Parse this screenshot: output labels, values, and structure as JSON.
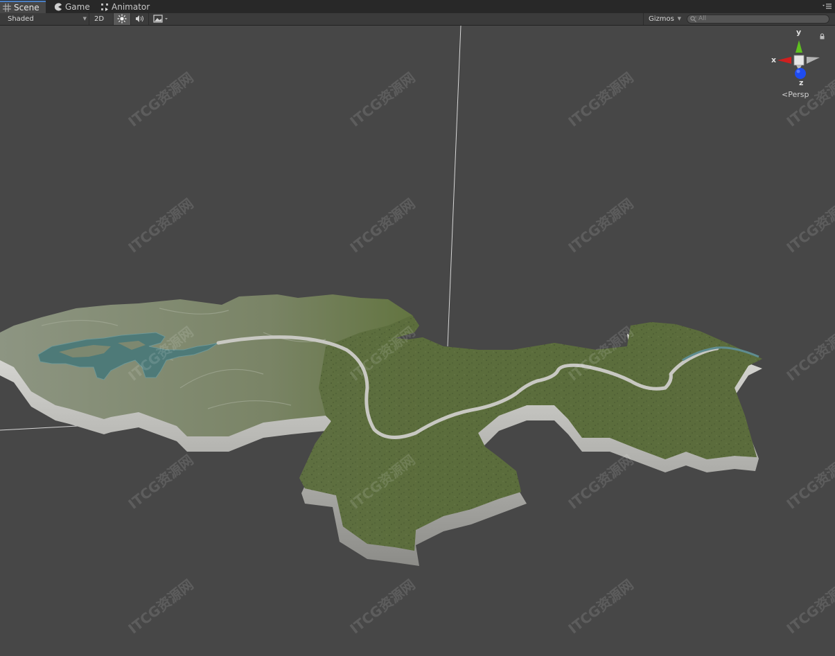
{
  "tabs": [
    {
      "label": "Scene",
      "icon": "scene-grid-icon",
      "active": true
    },
    {
      "label": "Game",
      "icon": "pacman-icon",
      "active": false
    },
    {
      "label": "Animator",
      "icon": "animator-icon",
      "active": false
    }
  ],
  "toolbar": {
    "draw_mode": "Shaded",
    "mode_2d": "2D",
    "lighting_icon": "sun-icon",
    "audio_icon": "speaker-icon",
    "effects_icon": "image-icon",
    "gizmos_label": "Gizmos",
    "search_placeholder": "All"
  },
  "gizmo": {
    "y_label": "y",
    "x_label": "x",
    "z_label": "z",
    "projection_label": "Persp",
    "colors": {
      "x": "#d01f1f",
      "y": "#5fc11f",
      "z": "#1f4cf0",
      "neutral": "#c8c8c8"
    }
  },
  "watermark_text": "ITCG资源网",
  "colors": {
    "viewport": "#474747",
    "terrain_grass": "#5e7041",
    "terrain_rock": "#8a9080",
    "water": "#4e7a78",
    "road": "#c8c8c2"
  }
}
